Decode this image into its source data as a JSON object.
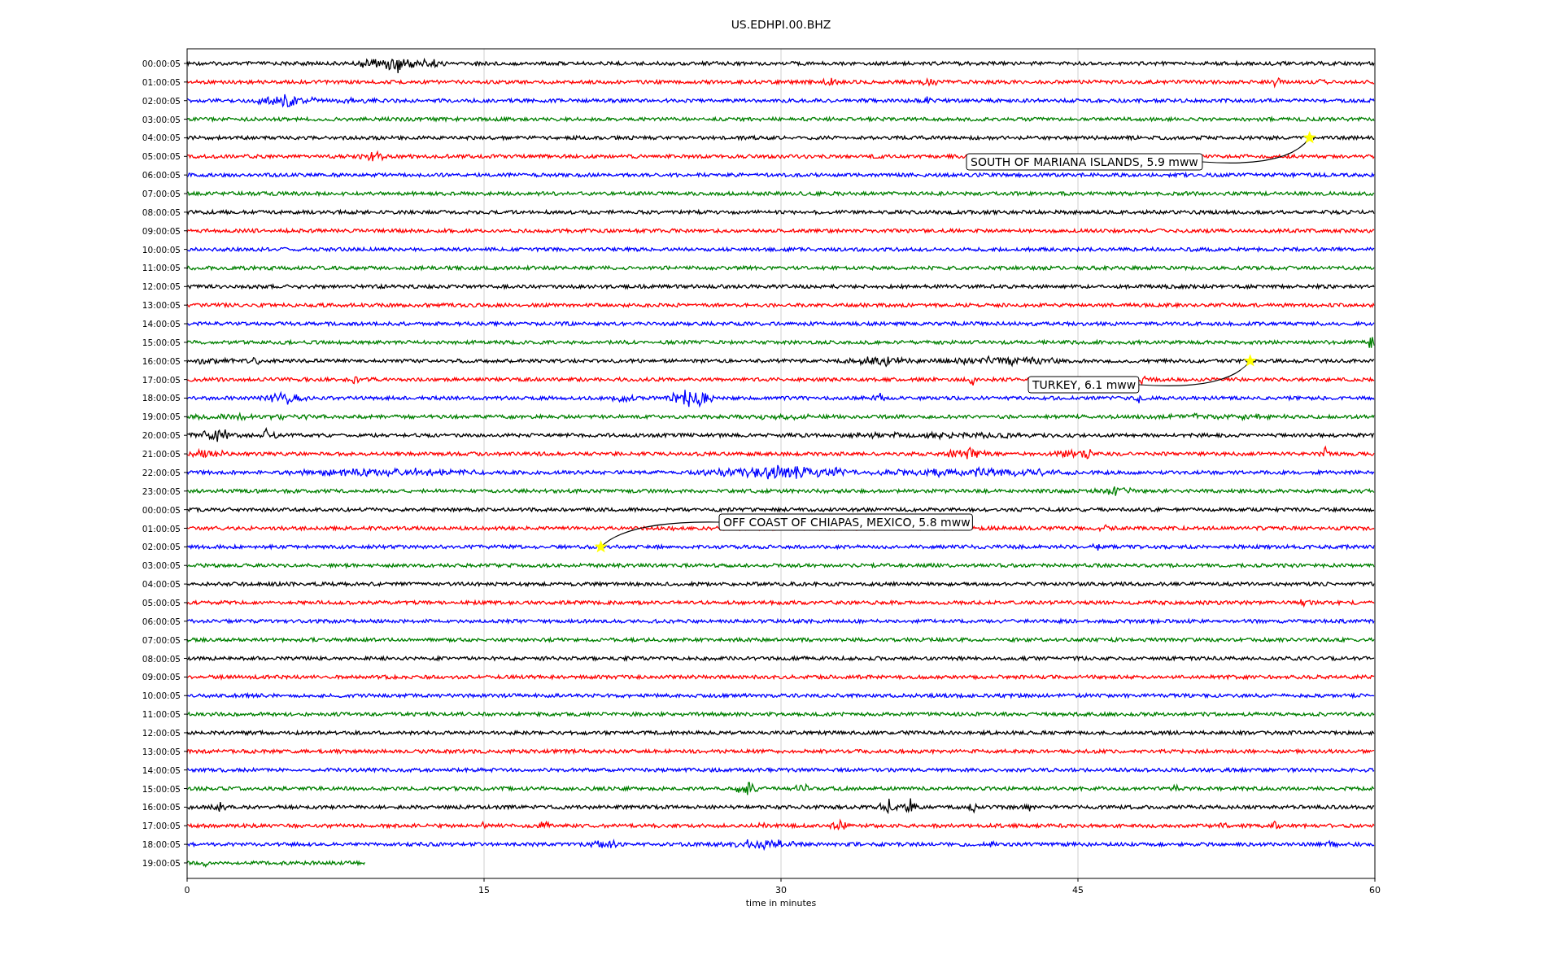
{
  "title": "US.EDHPI.00.BHZ",
  "rows": [
    {
      "label": "00:00:05",
      "color": "#000000",
      "kind": "full"
    },
    {
      "label": "01:00:05",
      "color": "#ff0000",
      "kind": "full"
    },
    {
      "label": "02:00:05",
      "color": "#0000ff",
      "kind": "full"
    },
    {
      "label": "03:00:05",
      "color": "#008000",
      "kind": "full"
    },
    {
      "label": "04:00:05",
      "color": "#000000",
      "kind": "full",
      "event": {
        "label": "SOUTH OF MARIANA ISLANDS, 5.9 mww"
      }
    },
    {
      "label": "05:00:05",
      "color": "#ff0000",
      "kind": "full"
    },
    {
      "label": "06:00:05",
      "color": "#0000ff",
      "kind": "full"
    },
    {
      "label": "07:00:05",
      "color": "#008000",
      "kind": "full"
    },
    {
      "label": "08:00:05",
      "color": "#000000",
      "kind": "full"
    },
    {
      "label": "09:00:05",
      "color": "#ff0000",
      "kind": "full"
    },
    {
      "label": "10:00:05",
      "color": "#0000ff",
      "kind": "full"
    },
    {
      "label": "11:00:05",
      "color": "#008000",
      "kind": "full"
    },
    {
      "label": "12:00:05",
      "color": "#000000",
      "kind": "full"
    },
    {
      "label": "13:00:05",
      "color": "#ff0000",
      "kind": "full"
    },
    {
      "label": "14:00:05",
      "color": "#0000ff",
      "kind": "full"
    },
    {
      "label": "15:00:05",
      "color": "#008000",
      "kind": "full"
    },
    {
      "label": "16:00:05",
      "color": "#000000",
      "kind": "full",
      "event": {
        "label": "TURKEY, 6.1 mww"
      }
    },
    {
      "label": "17:00:05",
      "color": "#ff0000",
      "kind": "full"
    },
    {
      "label": "18:00:05",
      "color": "#0000ff",
      "kind": "full"
    },
    {
      "label": "19:00:05",
      "color": "#008000",
      "kind": "full"
    },
    {
      "label": "20:00:05",
      "color": "#000000",
      "kind": "full"
    },
    {
      "label": "21:00:05",
      "color": "#ff0000",
      "kind": "full"
    },
    {
      "label": "22:00:05",
      "color": "#0000ff",
      "kind": "full"
    },
    {
      "label": "23:00:05",
      "color": "#008000",
      "kind": "full"
    },
    {
      "label": "00:00:05",
      "color": "#000000",
      "kind": "full"
    },
    {
      "label": "01:00:05",
      "color": "#ff0000",
      "kind": "full"
    },
    {
      "label": "02:00:05",
      "color": "#0000ff",
      "kind": "full",
      "event": {
        "label": "OFF COAST OF CHIAPAS, MEXICO, 5.8 mww"
      }
    },
    {
      "label": "03:00:05",
      "color": "#008000",
      "kind": "full"
    },
    {
      "label": "04:00:05",
      "color": "#000000",
      "kind": "full"
    },
    {
      "label": "05:00:05",
      "color": "#ff0000",
      "kind": "full"
    },
    {
      "label": "06:00:05",
      "color": "#0000ff",
      "kind": "full"
    },
    {
      "label": "07:00:05",
      "color": "#008000",
      "kind": "full"
    },
    {
      "label": "08:00:05",
      "color": "#000000",
      "kind": "full"
    },
    {
      "label": "09:00:05",
      "color": "#ff0000",
      "kind": "full"
    },
    {
      "label": "10:00:05",
      "color": "#0000ff",
      "kind": "full"
    },
    {
      "label": "11:00:05",
      "color": "#008000",
      "kind": "full"
    },
    {
      "label": "12:00:05",
      "color": "#000000",
      "kind": "full"
    },
    {
      "label": "13:00:05",
      "color": "#ff0000",
      "kind": "full"
    },
    {
      "label": "14:00:05",
      "color": "#0000ff",
      "kind": "full"
    },
    {
      "label": "15:00:05",
      "color": "#008000",
      "kind": "full"
    },
    {
      "label": "16:00:05",
      "color": "#000000",
      "kind": "full"
    },
    {
      "label": "17:00:05",
      "color": "#ff0000",
      "kind": "full"
    },
    {
      "label": "18:00:05",
      "color": "#0000ff",
      "kind": "full"
    },
    {
      "label": "19:00:05",
      "color": "#008000",
      "kind": "partial"
    }
  ],
  "x_axis": {
    "ticks": [
      "0",
      "15",
      "30",
      "45",
      "60"
    ],
    "label": "time in minutes"
  }
}
